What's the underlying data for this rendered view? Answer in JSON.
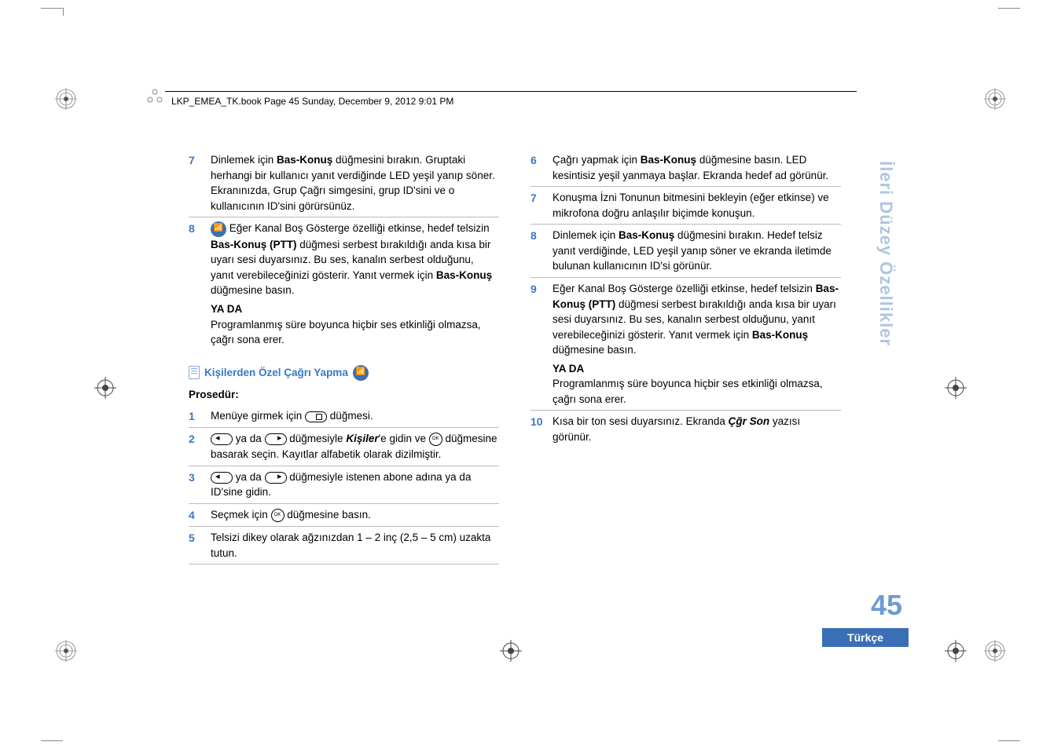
{
  "header": {
    "text": "LKP_EMEA_TK.book  Page 45  Sunday, December 9, 2012  9:01 PM"
  },
  "left": {
    "steps_top": [
      {
        "num": "7",
        "parts": [
          {
            "t": "Dinlemek için "
          },
          {
            "t": "Bas-Konuş",
            "b": true
          },
          {
            "t": " düğmesini bırakın. Gruptaki herhangi bir kullanıcı yanıt verdiğinde LED yeşil yanıp söner. Ekranınızda, Grup Çağrı simgesini, grup ID'sini ve o kullanıcının ID'sini görürsünüz."
          }
        ]
      },
      {
        "num": "8",
        "icon": "blue",
        "parts": [
          {
            "t": " Eğer Kanal Boş Gösterge özelliği etkinse, hedef telsizin "
          },
          {
            "t": "Bas-Konuş (PTT)",
            "b": true
          },
          {
            "t": " düğmesi serbest bırakıldığı anda kısa bir uyarı sesi duyarsınız. Bu ses, kanalın serbest olduğunu, yanıt verebileceğinizi gösterir. Yanıt vermek için "
          },
          {
            "t": "Bas-Konuş",
            "b": true
          },
          {
            "t": " düğmesine basın."
          }
        ],
        "yada": "YA DA",
        "after": "Programlanmış süre boyunca hiçbir ses etkinliği olmazsa, çağrı sona erer."
      }
    ],
    "section_title": "Kişilerden Özel Çağrı Yapma",
    "procedure_label": "Prosedür:",
    "steps_proc": [
      {
        "num": "1",
        "parts": [
          {
            "t": "Menüye girmek için "
          },
          {
            "icon": "rect"
          },
          {
            "t": " düğmesi."
          }
        ]
      },
      {
        "num": "2",
        "parts": [
          {
            "icon": "oval-left"
          },
          {
            "t": " ya da "
          },
          {
            "icon": "oval-right"
          },
          {
            "t": " düğmesiyle "
          },
          {
            "t": "Kişiler",
            "i": true
          },
          {
            "t": "'e gidin ve "
          },
          {
            "icon": "ok"
          },
          {
            "t": " düğmesine basarak seçin. Kayıtlar alfabetik olarak dizilmiştir."
          }
        ]
      },
      {
        "num": "3",
        "parts": [
          {
            "icon": "oval-left"
          },
          {
            "t": " ya da "
          },
          {
            "icon": "oval-right"
          },
          {
            "t": " düğmesiyle istenen abone adına ya da ID'sine gidin."
          }
        ]
      },
      {
        "num": "4",
        "parts": [
          {
            "t": "Seçmek için "
          },
          {
            "icon": "ok"
          },
          {
            "t": " düğmesine basın."
          }
        ]
      },
      {
        "num": "5",
        "parts": [
          {
            "t": "Telsizi dikey olarak ağzınızdan 1 – 2 inç (2,5 – 5 cm) uzakta tutun."
          }
        ]
      }
    ]
  },
  "right": {
    "steps": [
      {
        "num": "6",
        "parts": [
          {
            "t": "Çağrı yapmak için "
          },
          {
            "t": "Bas-Konuş",
            "b": true
          },
          {
            "t": " düğmesine basın. LED kesintisiz yeşil yanmaya başlar. Ekranda hedef ad görünür."
          }
        ]
      },
      {
        "num": "7",
        "parts": [
          {
            "t": "Konuşma İzni Tonunun bitmesini bekleyin (eğer etkinse) ve mikrofona doğru anlaşılır biçimde konuşun."
          }
        ]
      },
      {
        "num": "8",
        "parts": [
          {
            "t": "Dinlemek için "
          },
          {
            "t": "Bas-Konuş",
            "b": true
          },
          {
            "t": " düğmesini bırakın. Hedef telsiz yanıt verdiğinde, LED yeşil yanıp söner ve ekranda iletimde bulunan kullanıcının ID'si görünür."
          }
        ]
      },
      {
        "num": "9",
        "parts": [
          {
            "t": "Eğer Kanal Boş Gösterge özelliği etkinse, hedef telsizin "
          },
          {
            "t": "Bas-Konuş (PTT)",
            "b": true
          },
          {
            "t": " düğmesi serbest bırakıldığı anda kısa bir uyarı sesi duyarsınız. Bu ses, kanalın serbest olduğunu, yanıt verebileceğinizi gösterir. Yanıt vermek için "
          },
          {
            "t": "Bas-Konuş",
            "b": true
          },
          {
            "t": " düğmesine basın."
          }
        ],
        "yada": "YA DA",
        "after": "Programlanmış süre boyunca hiçbir ses etkinliği olmazsa, çağrı sona erer."
      },
      {
        "num": "10",
        "parts": [
          {
            "t": "Kısa bir ton sesi duyarsınız. Ekranda "
          },
          {
            "t": "Çğr Son",
            "i": true
          },
          {
            "t": " yazısı görünür."
          }
        ]
      }
    ]
  },
  "side_label": "İleri Düzey Özellikler",
  "page_number": "45",
  "language": "Türkçe"
}
